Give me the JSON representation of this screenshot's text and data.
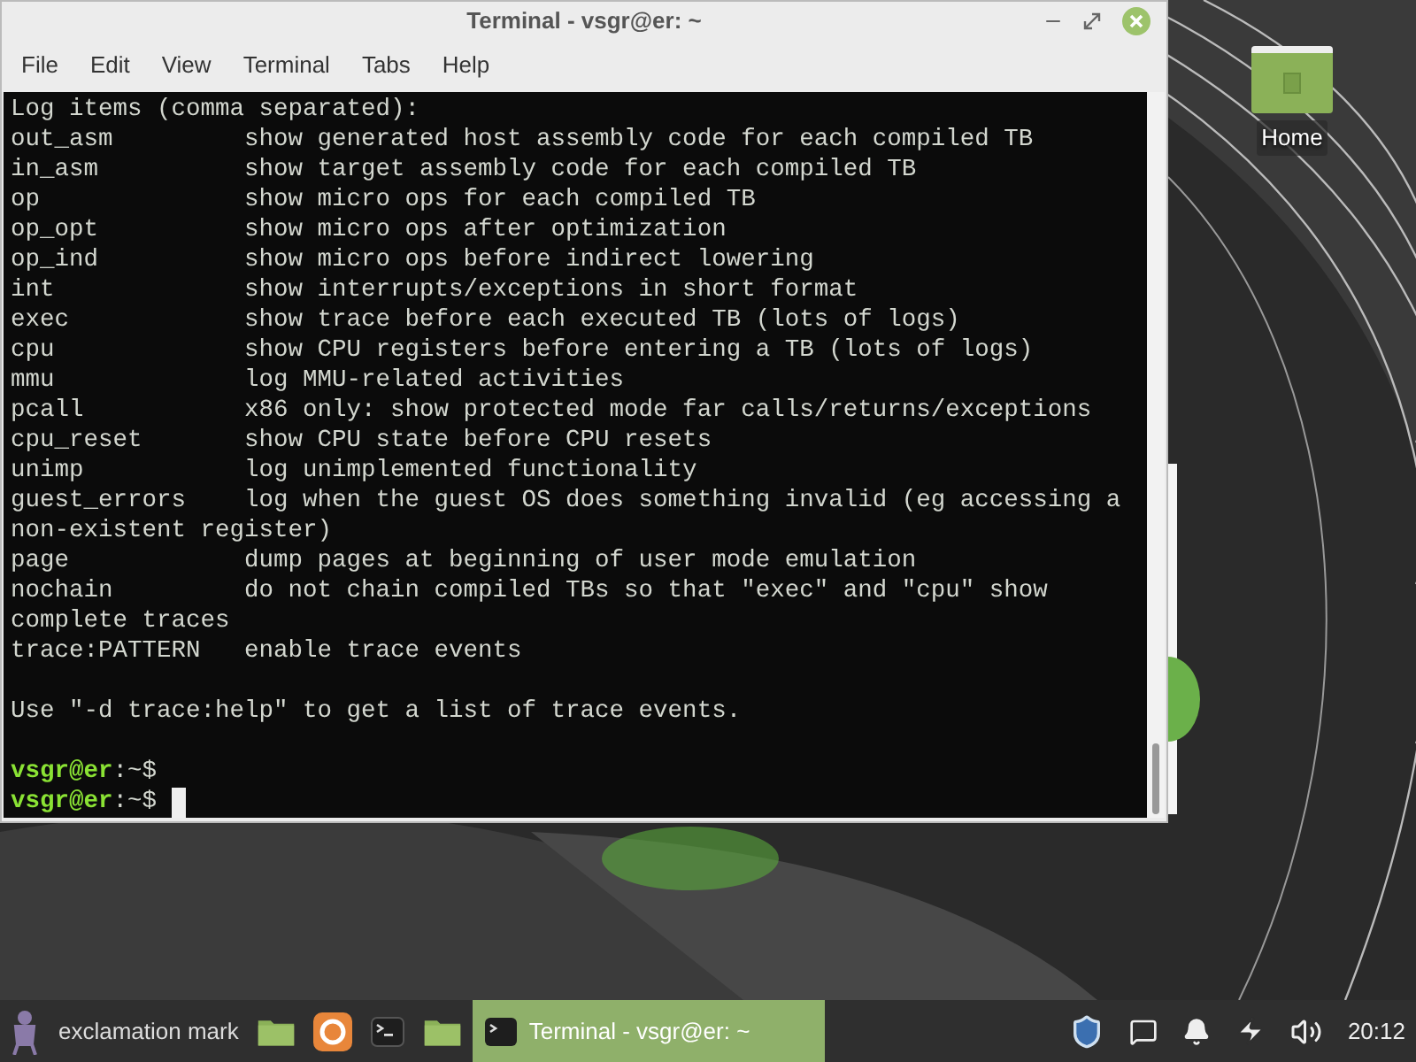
{
  "window": {
    "title": "Terminal - vsgr@er: ~"
  },
  "menu": [
    "File",
    "Edit",
    "View",
    "Terminal",
    "Tabs",
    "Help"
  ],
  "terminal": {
    "lines": [
      {
        "kind": "text",
        "text": "Log items (comma separated):"
      },
      {
        "kind": "text",
        "text": "out_asm         show generated host assembly code for each compiled TB"
      },
      {
        "kind": "text",
        "text": "in_asm          show target assembly code for each compiled TB"
      },
      {
        "kind": "text",
        "text": "op              show micro ops for each compiled TB"
      },
      {
        "kind": "text",
        "text": "op_opt          show micro ops after optimization"
      },
      {
        "kind": "text",
        "text": "op_ind          show micro ops before indirect lowering"
      },
      {
        "kind": "text",
        "text": "int             show interrupts/exceptions in short format"
      },
      {
        "kind": "text",
        "text": "exec            show trace before each executed TB (lots of logs)"
      },
      {
        "kind": "text",
        "text": "cpu             show CPU registers before entering a TB (lots of logs)"
      },
      {
        "kind": "text",
        "text": "mmu             log MMU-related activities"
      },
      {
        "kind": "text",
        "text": "pcall           x86 only: show protected mode far calls/returns/exceptions"
      },
      {
        "kind": "text",
        "text": "cpu_reset       show CPU state before CPU resets"
      },
      {
        "kind": "text",
        "text": "unimp           log unimplemented functionality"
      },
      {
        "kind": "text",
        "text": "guest_errors    log when the guest OS does something invalid (eg accessing a"
      },
      {
        "kind": "text",
        "text": "non-existent register)"
      },
      {
        "kind": "text",
        "text": "page            dump pages at beginning of user mode emulation"
      },
      {
        "kind": "text",
        "text": "nochain         do not chain compiled TBs so that \"exec\" and \"cpu\" show"
      },
      {
        "kind": "text",
        "text": "complete traces"
      },
      {
        "kind": "text",
        "text": "trace:PATTERN   enable trace events"
      },
      {
        "kind": "blank"
      },
      {
        "kind": "text",
        "text": "Use \"-d trace:help\" to get a list of trace events."
      },
      {
        "kind": "blank"
      },
      {
        "kind": "prompt",
        "user": "vsgr@er",
        "path": ":~$"
      },
      {
        "kind": "prompt",
        "user": "vsgr@er",
        "path": ":~$",
        "cursor": true
      }
    ]
  },
  "desktop": {
    "icons": [
      {
        "label": "Home"
      }
    ]
  },
  "taskbar": {
    "menu_label": "exclamation mark",
    "window_buttons": [
      {
        "label": "Terminal - vsgr@er: ~",
        "selected": true
      }
    ],
    "clock": "20:12"
  }
}
